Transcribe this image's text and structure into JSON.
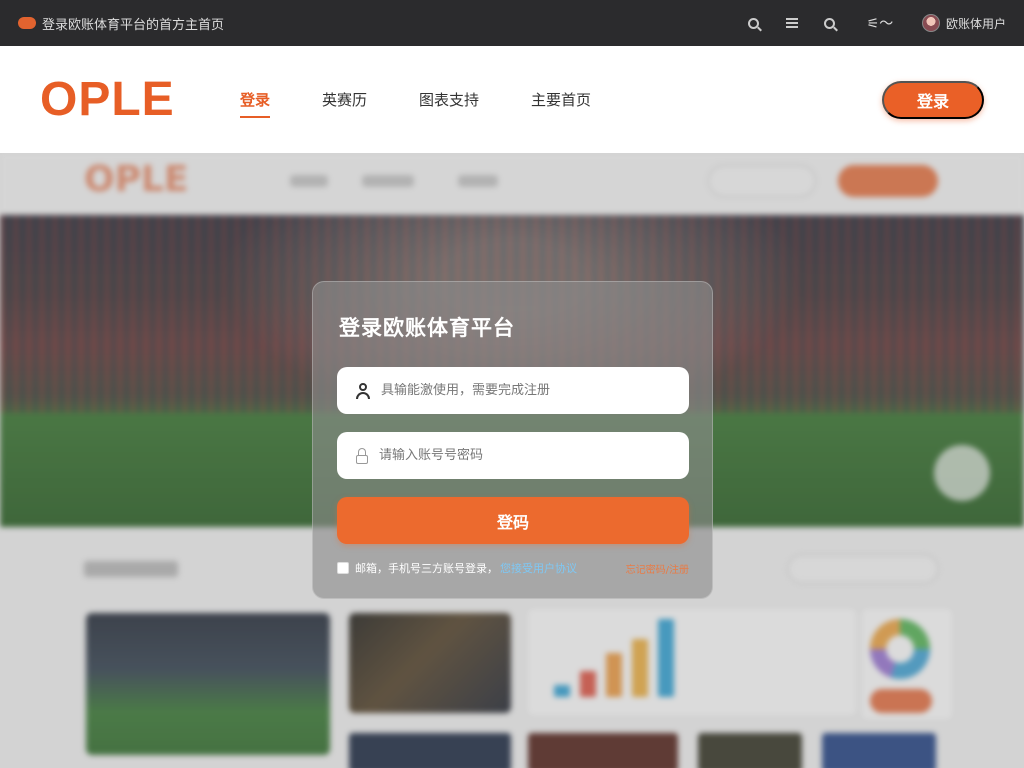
{
  "topbar": {
    "title": "登录欧账体育平台的首方主首页",
    "user_name": "欧账体用户"
  },
  "navbar": {
    "logo": "OPLE",
    "items": [
      {
        "label": "登录",
        "active": true
      },
      {
        "label": "英赛历"
      },
      {
        "label": "图表支持"
      },
      {
        "label": "主要首页"
      }
    ],
    "login_button": "登录"
  },
  "background": {
    "logo": "OPLE"
  },
  "modal": {
    "title": "登录欧账体育平台",
    "username_placeholder": "具输能激使用，需要完成注册",
    "password_placeholder": "请输入账号号密码",
    "submit_label": "登码",
    "agree_text": "邮箱，手机号三方账号登录，",
    "agree_link": "您接受用户协议",
    "forgot_link": "忘记密码/注册"
  },
  "colors": {
    "accent": "#ea6027",
    "topbar_bg": "#2b2b2d",
    "link_blue": "#7ec8f5"
  }
}
